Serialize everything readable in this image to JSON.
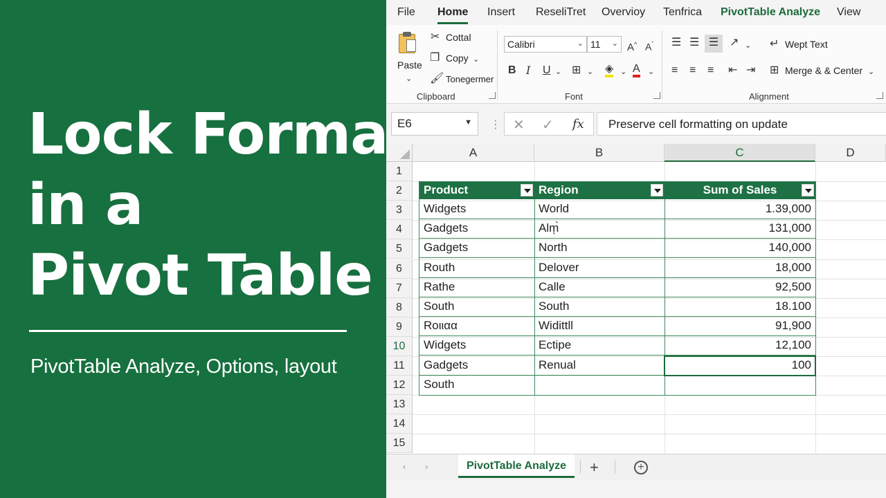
{
  "banner": {
    "title_lines": [
      "Lock Format",
      "in a",
      "Pivot Table"
    ],
    "subtitle": "PivotTable Analyze, Options, layout"
  },
  "ribbon_tabs": [
    "File",
    "Home",
    "Insert",
    "ReseliTret",
    "Overvioy",
    "Tenfrica",
    "PivotTable Analyze",
    "View"
  ],
  "ribbon": {
    "clipboard": {
      "paste": "Paste",
      "cut": "Cottal",
      "copy": "Copy",
      "format_painter": "Tonegermer",
      "label": "Clipboard"
    },
    "font": {
      "name": "Calibri",
      "size": "11",
      "bold": "B",
      "italic": "I",
      "underline": "U",
      "label": "Font"
    },
    "alignment": {
      "wrap_text": "Wept Text",
      "merge_center": "Merge & & Center",
      "label": "Alignment"
    }
  },
  "formula_bar": {
    "name_box": "E6",
    "fx": "fx",
    "content": "Preserve cell formatting on update"
  },
  "grid": {
    "columns": [
      "A",
      "B",
      "C",
      "D"
    ],
    "selected_column": "C",
    "rows": [
      "1",
      "2",
      "3",
      "4",
      "5",
      "6",
      "7",
      "8",
      "9",
      "10",
      "11",
      "12",
      "13",
      "14",
      "15"
    ],
    "selected_row": "10"
  },
  "pivot": {
    "headers": [
      "Product",
      "Region",
      "Sum of Sales"
    ],
    "rows": [
      [
        "Widgets",
        "World",
        "1.39,000"
      ],
      [
        "Gadgets",
        "Alm̖̀",
        "131,000"
      ],
      [
        "Gadgets",
        "North",
        "140,000"
      ],
      [
        "Routh",
        "Delover",
        "18,000"
      ],
      [
        "Rathe",
        "Calle",
        "92,500"
      ],
      [
        "South",
        "South",
        "18.100"
      ],
      [
        "Roιιαα",
        "Widittll",
        "91,900"
      ],
      [
        "Widgets",
        "Ectipe",
        "12,100"
      ],
      [
        "Gadgets",
        "Renual",
        "100"
      ],
      [
        "South",
        "",
        ""
      ]
    ]
  },
  "sheet_tabs": {
    "active": "PivotTable Analyze",
    "add": "+"
  },
  "colors": {
    "banner_bg": "#17703f",
    "accent": "#1c6b3c",
    "pivot_header": "#1e7145"
  },
  "icons": [
    "paste-icon",
    "cut-icon",
    "copy-icon",
    "format-painter-icon",
    "fill-color-icon",
    "font-color-icon",
    "wrap-text-icon",
    "merge-center-icon",
    "filter-dropdown-icon"
  ]
}
